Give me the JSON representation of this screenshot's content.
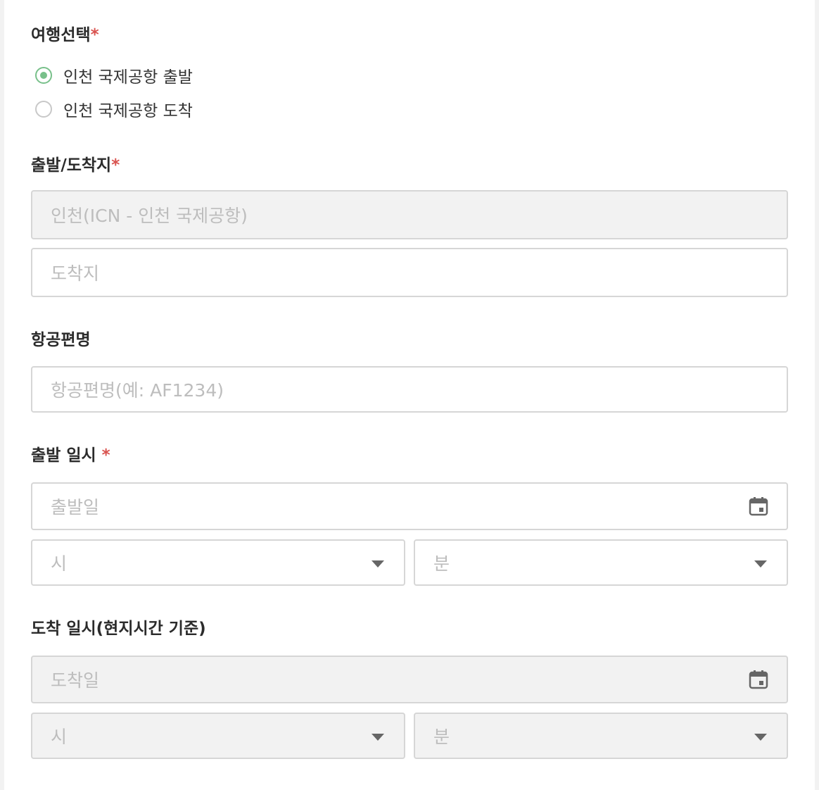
{
  "trip": {
    "title": "여행선택",
    "required_mark": "*",
    "options": [
      {
        "label": "인천 국제공항 출발",
        "checked": true
      },
      {
        "label": "인천 국제공항 도착",
        "checked": false
      }
    ]
  },
  "route": {
    "title": "출발/도착지",
    "required_mark": "*",
    "origin_value": "인천(ICN - 인천 국제공항)",
    "destination_placeholder": "도착지"
  },
  "flight": {
    "title": "항공편명",
    "placeholder": "항공편명(예: AF1234)"
  },
  "departure": {
    "title": "출발 일시",
    "required_mark": "*",
    "date_placeholder": "출발일",
    "hour_placeholder": "시",
    "minute_placeholder": "분"
  },
  "arrival": {
    "title": "도착 일시(현지시간 기준)",
    "date_placeholder": "도착일",
    "hour_placeholder": "시",
    "minute_placeholder": "분"
  },
  "icons": {
    "calendar": "calendar-icon",
    "dropdown": "chevron-down-icon"
  },
  "colors": {
    "accent": "#78c08a",
    "required": "#d9534f",
    "disabled_bg": "#f2f2f2",
    "border": "#d6d6d6"
  }
}
